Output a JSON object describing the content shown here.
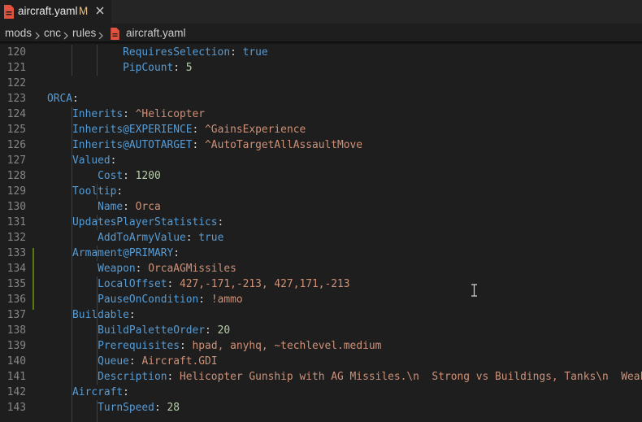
{
  "tab": {
    "title": "aircraft.yaml",
    "modified": "M",
    "file_icon": "yaml-file-icon",
    "close_icon": "close-icon"
  },
  "breadcrumb": {
    "items": [
      "mods",
      "cnc",
      "rules",
      "aircraft.yaml"
    ],
    "separator_icon": "chevron-right-icon"
  },
  "editor": {
    "lines": [
      {
        "n": "120",
        "indent": "            ",
        "key": "RequiresSelection",
        "sep": ": ",
        "val": "true",
        "vtype": "bool"
      },
      {
        "n": "121",
        "indent": "            ",
        "key": "PipCount",
        "sep": ": ",
        "val": "5",
        "vtype": "num"
      },
      {
        "n": "122",
        "indent": "",
        "key": "",
        "sep": "",
        "val": "",
        "vtype": "str"
      },
      {
        "n": "123",
        "indent": "",
        "key": "ORCA",
        "sep": ":",
        "val": "",
        "vtype": "str"
      },
      {
        "n": "124",
        "indent": "    ",
        "key": "Inherits",
        "sep": ": ",
        "val": "^Helicopter",
        "vtype": "str"
      },
      {
        "n": "125",
        "indent": "    ",
        "key": "Inherits@EXPERIENCE",
        "sep": ": ",
        "val": "^GainsExperience",
        "vtype": "str"
      },
      {
        "n": "126",
        "indent": "    ",
        "key": "Inherits@AUTOTARGET",
        "sep": ": ",
        "val": "^AutoTargetAllAssaultMove",
        "vtype": "str"
      },
      {
        "n": "127",
        "indent": "    ",
        "key": "Valued",
        "sep": ":",
        "val": "",
        "vtype": "str"
      },
      {
        "n": "128",
        "indent": "        ",
        "key": "Cost",
        "sep": ": ",
        "val": "1200",
        "vtype": "num"
      },
      {
        "n": "129",
        "indent": "    ",
        "key": "Tooltip",
        "sep": ":",
        "val": "",
        "vtype": "str"
      },
      {
        "n": "130",
        "indent": "        ",
        "key": "Name",
        "sep": ": ",
        "val": "Orca",
        "vtype": "str"
      },
      {
        "n": "131",
        "indent": "    ",
        "key": "UpdatesPlayerStatistics",
        "sep": ":",
        "val": "",
        "vtype": "str"
      },
      {
        "n": "132",
        "indent": "        ",
        "key": "AddToArmyValue",
        "sep": ": ",
        "val": "true",
        "vtype": "bool"
      },
      {
        "n": "133",
        "indent": "    ",
        "key": "Armament@PRIMARY",
        "sep": ":",
        "val": "",
        "vtype": "str"
      },
      {
        "n": "134",
        "indent": "        ",
        "key": "Weapon",
        "sep": ": ",
        "val": "OrcaAGMissiles",
        "vtype": "str"
      },
      {
        "n": "135",
        "indent": "        ",
        "key": "LocalOffset",
        "sep": ": ",
        "val": "427,-171,-213, 427,171,-213",
        "vtype": "str"
      },
      {
        "n": "136",
        "indent": "        ",
        "key": "PauseOnCondition",
        "sep": ": ",
        "val": "!ammo",
        "vtype": "str"
      },
      {
        "n": "137",
        "indent": "    ",
        "key": "Buildable",
        "sep": ":",
        "val": "",
        "vtype": "str"
      },
      {
        "n": "138",
        "indent": "        ",
        "key": "BuildPaletteOrder",
        "sep": ": ",
        "val": "20",
        "vtype": "num"
      },
      {
        "n": "139",
        "indent": "        ",
        "key": "Prerequisites",
        "sep": ": ",
        "val": "hpad, anyhq, ~techlevel.medium",
        "vtype": "str"
      },
      {
        "n": "140",
        "indent": "        ",
        "key": "Queue",
        "sep": ": ",
        "val": "Aircraft.GDI",
        "vtype": "str"
      },
      {
        "n": "141",
        "indent": "        ",
        "key": "Description",
        "sep": ": ",
        "val": "Helicopter Gunship with AG Missiles.\\n  Strong vs Buildings, Tanks\\n  Weak",
        "vtype": "str"
      },
      {
        "n": "142",
        "indent": "    ",
        "key": "Aircraft",
        "sep": ":",
        "val": "",
        "vtype": "str"
      },
      {
        "n": "143",
        "indent": "        ",
        "key": "TurnSpeed",
        "sep": ": ",
        "val": "28",
        "vtype": "num"
      }
    ]
  },
  "colors": {
    "key": "#569cd6",
    "string": "#ce9178",
    "number": "#b5cea8",
    "modified_gutter": "#587c0c",
    "tab_modified": "#e2c08d"
  }
}
